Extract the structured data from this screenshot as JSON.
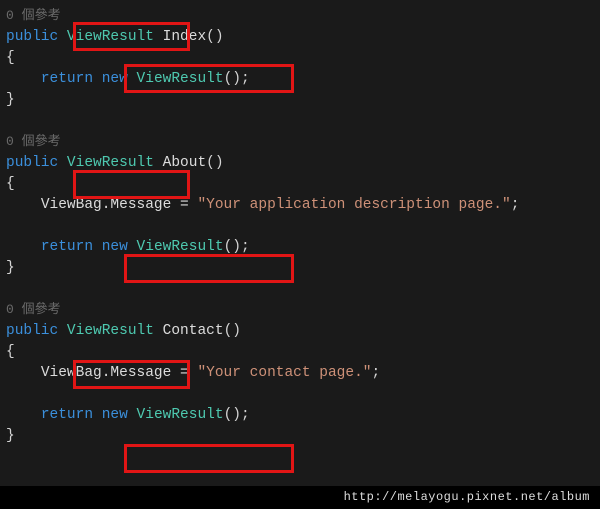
{
  "code": {
    "codelens": "0 個參考",
    "kw_public": "public",
    "kw_return": "return",
    "kw_new": "new",
    "type_viewresult": "ViewResult",
    "brace_open": "{",
    "brace_close": "}",
    "paren_pair": "()",
    "ctor_call_tail": "();",
    "semicolon": ";",
    "m1_name": "Index",
    "m2_name": "About",
    "m3_name": "Contact",
    "msg_assign_head": "ViewBag.Message = ",
    "m2_string": "\"Your application description page.\"",
    "m3_string": "\"Your contact page.\""
  },
  "footer": {
    "text": "http://melayogu.pixnet.net/album"
  },
  "highlight_color": "#e11515"
}
